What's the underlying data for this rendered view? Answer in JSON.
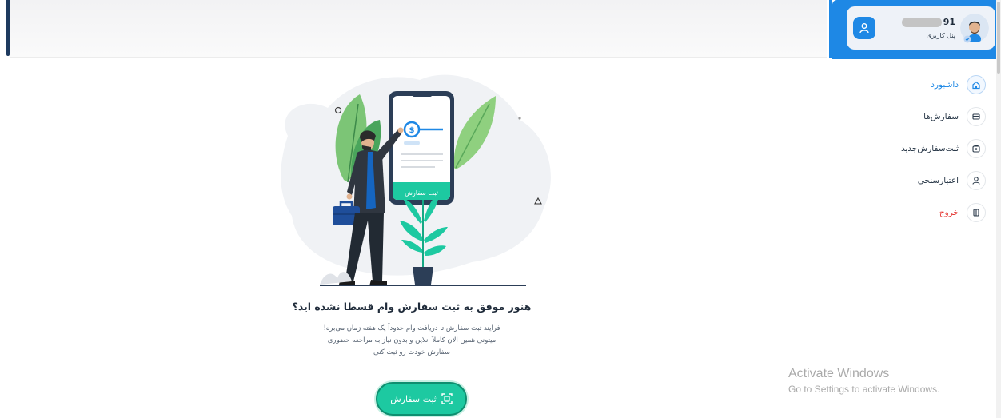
{
  "profile": {
    "user_id_prefix": "91",
    "panel_label": "پنل کاربری"
  },
  "sidebar": {
    "items": [
      {
        "label": "داشبورد",
        "icon": "home-icon",
        "state": "active"
      },
      {
        "label": "سفارش‌ها",
        "icon": "orders-icon",
        "state": "normal"
      },
      {
        "label": "ثبت‌سفارش‌جدید",
        "icon": "new-order-icon",
        "state": "normal"
      },
      {
        "label": "اعتبارسنجی",
        "icon": "user-check-icon",
        "state": "normal"
      },
      {
        "label": "خروج",
        "icon": "logout-icon",
        "state": "danger"
      }
    ]
  },
  "illustration": {
    "phone_button_label": "ثبت سفارش"
  },
  "empty_state": {
    "title": "هنوز موفق به ثبت سفارش وام قسطا نشده اید؟",
    "description_lines": [
      "فرایند ثبت سفارش تا دریافت وام حدوداً یک هفته زمان می‌بره!",
      "میتونی همین الان کاملاً آنلاین و بدون نیاز به مراجعه حضوری",
      "سفارش خودت رو ثبت کنی"
    ],
    "cta_label": "ثبت سفارش"
  },
  "watermark": {
    "title": "Activate Windows",
    "subtitle": "Go to Settings to activate Windows."
  },
  "colors": {
    "primary": "#1e88e5",
    "accent": "#1dc9a1",
    "danger": "#e53935",
    "text": "#1f2b3a"
  }
}
